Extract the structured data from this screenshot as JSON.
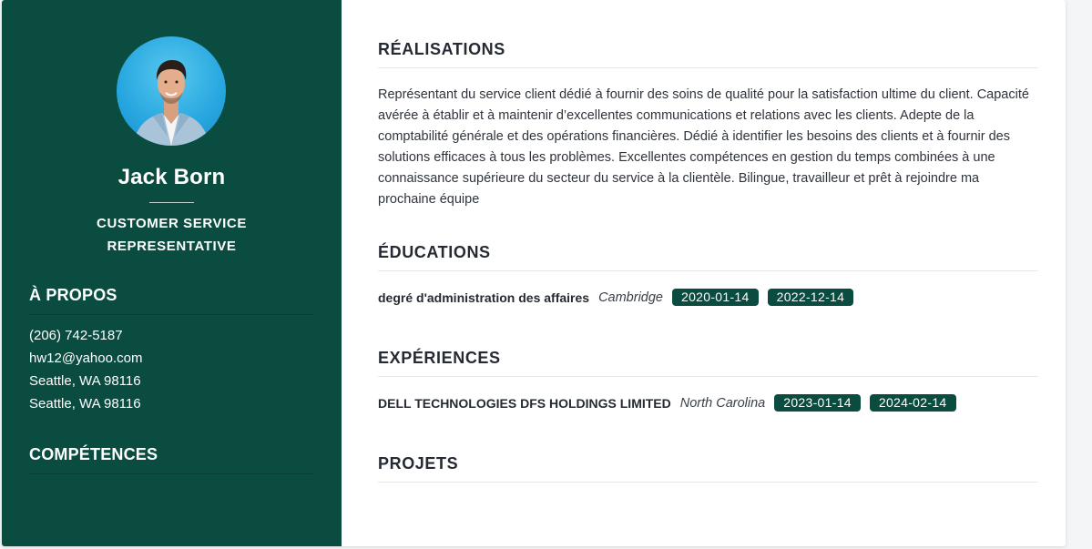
{
  "profile": {
    "name": "Jack Born",
    "role_line1": "CUSTOMER SERVICE",
    "role_line2": "REPRESENTATIVE"
  },
  "about": {
    "heading": "À PROPOS",
    "phone": "(206) 742-5187",
    "email": "hw12@yahoo.com",
    "address1": "Seattle, WA 98116",
    "address2": "Seattle, WA 98116"
  },
  "skills": {
    "heading": "COMPÉTENCES"
  },
  "achievements": {
    "heading": "RÉALISATIONS",
    "text": "Représentant du service client dédié à fournir des soins de qualité pour la satisfaction ultime du client. Capacité avérée à établir et à maintenir d’excellentes communications et relations avec les clients. Adepte de la comptabilité générale et des opérations financières. Dédié à identifier les besoins des clients et à fournir des solutions efficaces à tous les problèmes. Excellentes compétences en gestion du temps combinées à une connaissance supérieure du secteur du service à la clientèle. Bilingue, travailleur et prêt à rejoindre ma prochaine équipe"
  },
  "education": {
    "heading": "ÉDUCATIONS",
    "items": [
      {
        "title": "degré d'administration des affaires",
        "location": "Cambridge",
        "start": "2020-01-14",
        "end": "2022-12-14"
      }
    ]
  },
  "experience": {
    "heading": "EXPÉRIENCES",
    "items": [
      {
        "title": "DELL TECHNOLOGIES DFS HOLDINGS LIMITED",
        "location": "North Carolina",
        "start": "2023-01-14",
        "end": "2024-02-14"
      }
    ]
  },
  "projects": {
    "heading": "PROJETS"
  },
  "colors": {
    "sidebar": "#0a4c40",
    "badge": "#0a4c40",
    "text": "#252a33"
  }
}
